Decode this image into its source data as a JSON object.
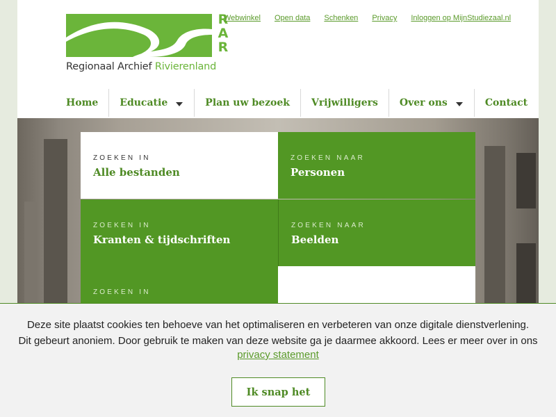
{
  "logo": {
    "letters": [
      "R",
      "A",
      "R"
    ],
    "name_part1": "Regionaal Archief ",
    "name_part2": "Rivierenland"
  },
  "top_links": [
    "Webwinkel",
    "Open data",
    "Schenken",
    "Privacy",
    "Inloggen op MijnStudiezaal.nl"
  ],
  "nav": {
    "home": "Home",
    "educatie": "Educatie",
    "plan": "Plan uw bezoek",
    "vrijwilligers": "Vrijwilligers",
    "over_ons": "Over ons",
    "contact": "Contact"
  },
  "tiles": [
    {
      "kicker": "ZOEKEN IN",
      "title": "Alle bestanden"
    },
    {
      "kicker": "ZOEKEN NAAR",
      "title": "Personen"
    },
    {
      "kicker": "ZOEKEN IN",
      "title": "Kranten & tijdschriften"
    },
    {
      "kicker": "ZOEKEN NAAR",
      "title": "Beelden"
    },
    {
      "kicker": "ZOEKEN IN",
      "title": ""
    }
  ],
  "cookie": {
    "line1": "Deze site plaatst cookies ten behoeve van het optimaliseren en verbeteren van onze digitale dienstverlening.",
    "line2": "Dit gebeurt anoniem. Door gebruik te maken van deze website ga je daarmee akkoord. Lees er meer over in ons",
    "link": "privacy statement",
    "button": "Ik snap het"
  },
  "colors": {
    "brand_green": "#6bb53a",
    "tile_green": "#529724",
    "link_green": "#4e8a24"
  }
}
